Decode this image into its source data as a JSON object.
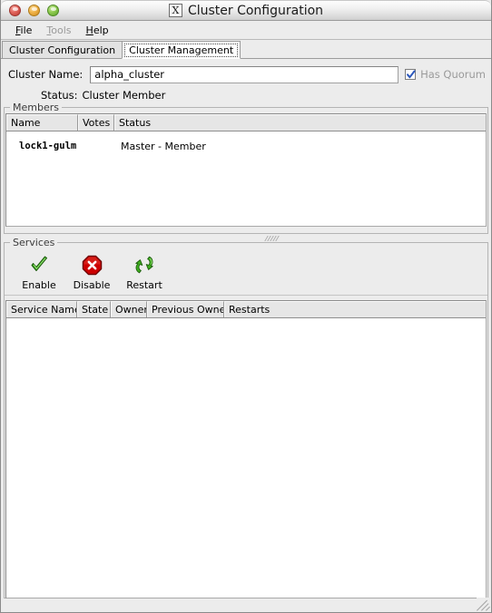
{
  "window": {
    "title": "Cluster Configuration",
    "logo_glyph": "X",
    "traffic_lights": [
      "close-button",
      "minimize-button",
      "zoom-button"
    ]
  },
  "menubar": {
    "items": [
      {
        "label": "File",
        "mnemonic": "F",
        "disabled": false
      },
      {
        "label": "Tools",
        "mnemonic": "T",
        "disabled": true
      },
      {
        "label": "Help",
        "mnemonic": "H",
        "disabled": false
      }
    ]
  },
  "tabs": [
    {
      "label": "Cluster Configuration",
      "selected": false
    },
    {
      "label": "Cluster Management",
      "selected": true
    }
  ],
  "cluster": {
    "name_label": "Cluster Name:",
    "name_value": "alpha_cluster",
    "name_placeholder": "",
    "quorum_label": "Has Quorum",
    "quorum_checked": true,
    "status_label": "Status:",
    "status_value": "Cluster Member"
  },
  "members": {
    "legend": "Members",
    "columns": [
      "Name",
      "Votes",
      "Status"
    ],
    "rows": [
      {
        "name": "lock1-gulm",
        "votes": "",
        "status": "Master - Member"
      }
    ]
  },
  "services": {
    "legend": "Services",
    "toolbar": [
      {
        "label": "Enable",
        "icon": "green-check-icon"
      },
      {
        "label": "Disable",
        "icon": "red-stop-x-icon"
      },
      {
        "label": "Restart",
        "icon": "green-recycle-arrows-icon"
      }
    ],
    "columns": [
      "Service Name",
      "State",
      "Owner",
      "Previous Owner",
      "Restarts"
    ],
    "rows": []
  },
  "colors": {
    "window_bg": "#ececec",
    "table_bg": "#ffffff",
    "header_bg": "#e6e6e6",
    "accent_check": "#2b57bb",
    "enable_green": "#35a218",
    "disable_red": "#cc0000",
    "disabled_text": "#9a9a9a"
  }
}
